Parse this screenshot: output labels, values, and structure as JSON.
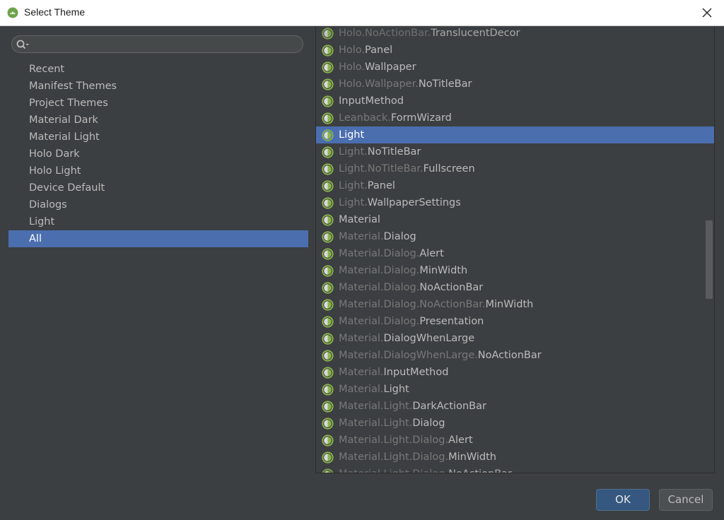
{
  "window": {
    "title": "Select Theme"
  },
  "search": {
    "placeholder": "",
    "value": ""
  },
  "categories": [
    {
      "label": "Recent"
    },
    {
      "label": "Manifest Themes"
    },
    {
      "label": "Project Themes"
    },
    {
      "label": "Material Dark"
    },
    {
      "label": "Material Light"
    },
    {
      "label": "Holo Dark"
    },
    {
      "label": "Holo Light"
    },
    {
      "label": "Device Default"
    },
    {
      "label": "Dialogs"
    },
    {
      "label": "Light"
    },
    {
      "label": "All"
    }
  ],
  "selected_category": "All",
  "themes": [
    {
      "prefix": "Holo.NoActionBar.",
      "name": "TranslucentDecor"
    },
    {
      "prefix": "Holo.",
      "name": "Panel"
    },
    {
      "prefix": "Holo.",
      "name": "Wallpaper"
    },
    {
      "prefix": "Holo.Wallpaper.",
      "name": "NoTitleBar"
    },
    {
      "prefix": "",
      "name": "InputMethod"
    },
    {
      "prefix": "Leanback.",
      "name": "FormWizard"
    },
    {
      "prefix": "",
      "name": "Light"
    },
    {
      "prefix": "Light.",
      "name": "NoTitleBar"
    },
    {
      "prefix": "Light.NoTitleBar.",
      "name": "Fullscreen"
    },
    {
      "prefix": "Light.",
      "name": "Panel"
    },
    {
      "prefix": "Light.",
      "name": "WallpaperSettings"
    },
    {
      "prefix": "",
      "name": "Material"
    },
    {
      "prefix": "Material.",
      "name": "Dialog"
    },
    {
      "prefix": "Material.Dialog.",
      "name": "Alert"
    },
    {
      "prefix": "Material.Dialog.",
      "name": "MinWidth"
    },
    {
      "prefix": "Material.Dialog.",
      "name": "NoActionBar"
    },
    {
      "prefix": "Material.Dialog.NoActionBar.",
      "name": "MinWidth"
    },
    {
      "prefix": "Material.Dialog.",
      "name": "Presentation"
    },
    {
      "prefix": "Material.",
      "name": "DialogWhenLarge"
    },
    {
      "prefix": "Material.DialogWhenLarge.",
      "name": "NoActionBar"
    },
    {
      "prefix": "Material.",
      "name": "InputMethod"
    },
    {
      "prefix": "Material.",
      "name": "Light"
    },
    {
      "prefix": "Material.Light.",
      "name": "DarkActionBar"
    },
    {
      "prefix": "Material.Light.",
      "name": "Dialog"
    },
    {
      "prefix": "Material.Light.Dialog.",
      "name": "Alert"
    },
    {
      "prefix": "Material.Light.Dialog.",
      "name": "MinWidth"
    },
    {
      "prefix": "Material.Light.Dialog.",
      "name": "NoActionBar"
    }
  ],
  "selected_theme": "Light",
  "buttons": {
    "ok": "OK",
    "cancel": "Cancel"
  },
  "colors": {
    "background": "#3c3f41",
    "selection": "#4b6eaf",
    "text": "#bbbbbb",
    "prefix_text": "#787878",
    "theme_icon": "#8ab54a"
  },
  "icons": {
    "app": "android-studio-icon",
    "close": "close-icon",
    "search": "search-icon",
    "theme": "theme-icon"
  }
}
